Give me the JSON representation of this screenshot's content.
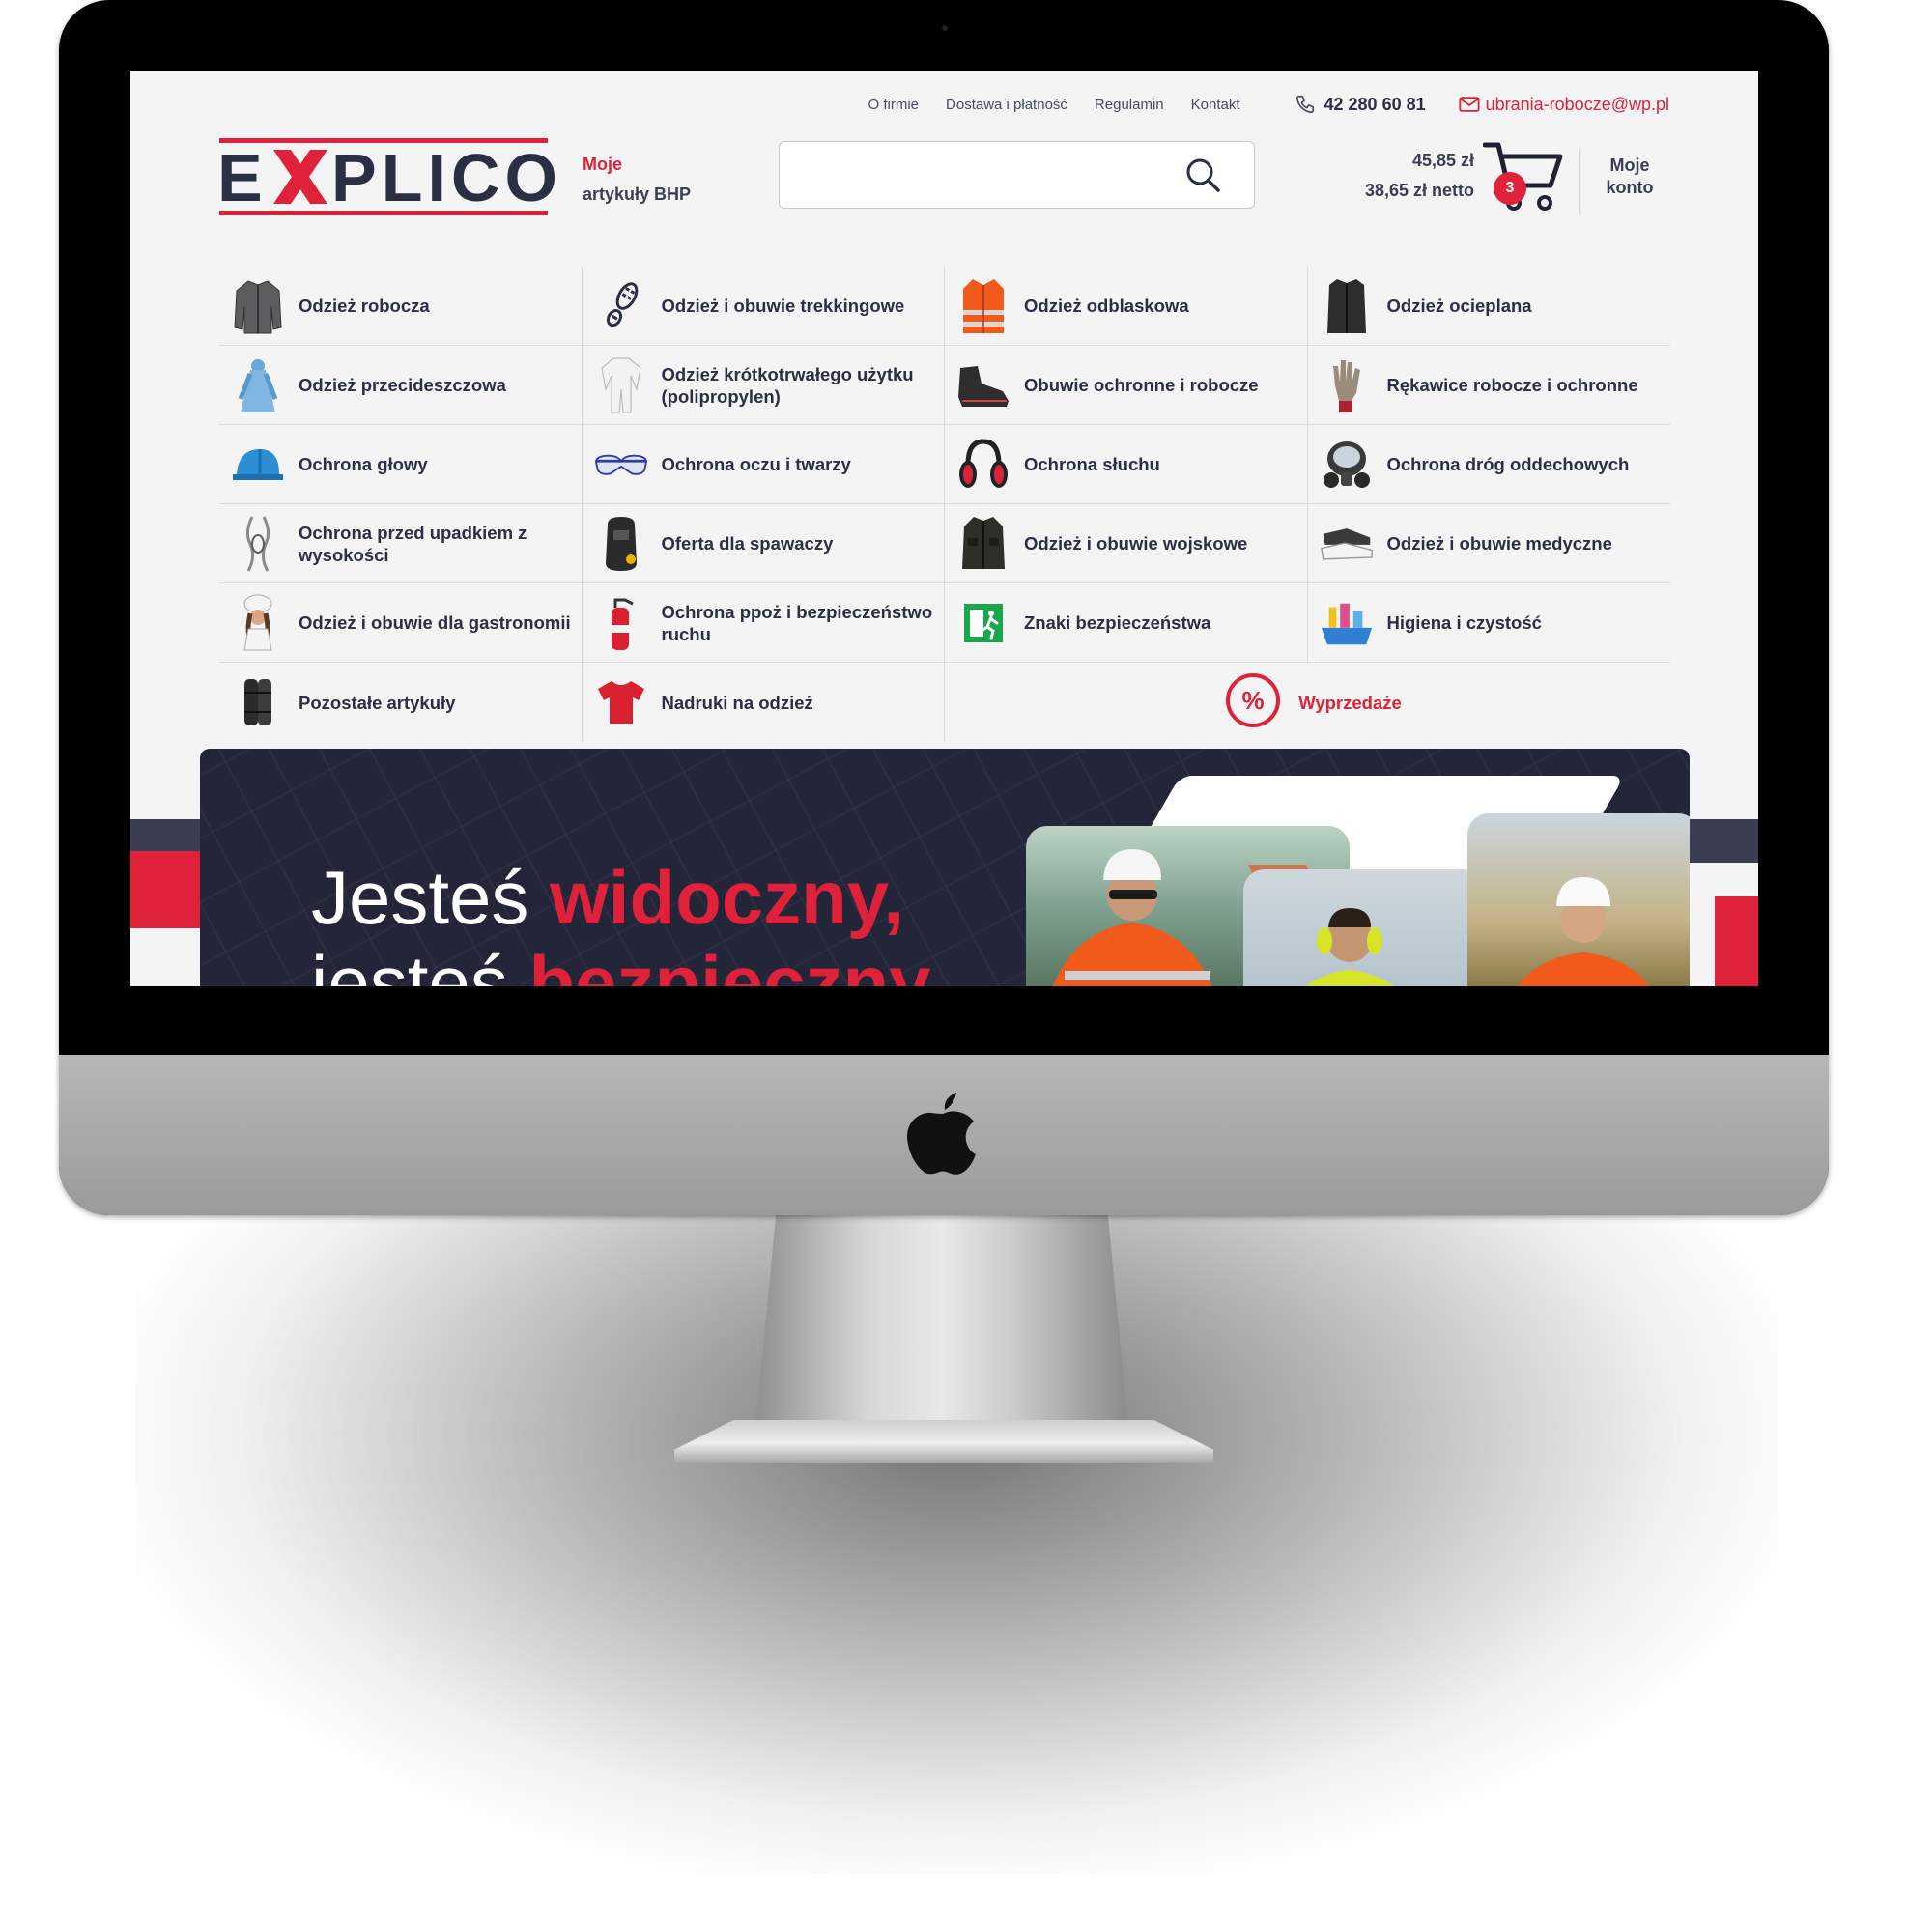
{
  "topnav": {
    "links": [
      "O firmie",
      "Dostawa i płatność",
      "Regulamin",
      "Kontakt"
    ],
    "phone": "42 280 60 81",
    "email": "ubrania-robocze@wp.pl"
  },
  "logo": {
    "text": "EXPLICO"
  },
  "slogan": {
    "line1": "Moje",
    "line2": "artykuły BHP"
  },
  "search": {
    "placeholder": "",
    "value": ""
  },
  "cart": {
    "gross": "45,85 zł",
    "net": "38,65 zł netto",
    "count": "3"
  },
  "account": {
    "line1": "Moje",
    "line2": "konto"
  },
  "categories": [
    {
      "label": "Odzież robocza",
      "icon": "jacket-icon"
    },
    {
      "label": "Odzież i obuwie trekkingowe",
      "icon": "footprint-icon"
    },
    {
      "label": "Odzież odblaskowa",
      "icon": "hi-vis-vest-icon"
    },
    {
      "label": "Odzież ocieplana",
      "icon": "insulated-vest-icon"
    },
    {
      "label": "Odzież przecideszczowa",
      "icon": "raincoat-icon"
    },
    {
      "label": "Odzież krótkotrwałego użytku (polipropylen)",
      "icon": "coverall-icon"
    },
    {
      "label": "Obuwie ochronne i robocze",
      "icon": "safety-boot-icon"
    },
    {
      "label": "Rękawice robocze i ochronne",
      "icon": "glove-icon"
    },
    {
      "label": "Ochrona głowy",
      "icon": "helmet-icon"
    },
    {
      "label": "Ochrona oczu i twarzy",
      "icon": "goggles-icon"
    },
    {
      "label": "Ochrona słuchu",
      "icon": "earmuffs-icon"
    },
    {
      "label": "Ochrona dróg oddechowych",
      "icon": "gas-mask-icon"
    },
    {
      "label": "Ochrona przed upadkiem z wysokości",
      "icon": "harness-icon"
    },
    {
      "label": "Oferta dla spawaczy",
      "icon": "welding-mask-icon"
    },
    {
      "label": "Odzież i obuwie wojskowe",
      "icon": "military-jacket-icon"
    },
    {
      "label": "Odzież i obuwie medyczne",
      "icon": "medical-shoes-icon"
    },
    {
      "label": "Odzież i obuwie dla gastronomii",
      "icon": "chef-icon"
    },
    {
      "label": "Ochrona ppoż i bezpieczeństwo ruchu",
      "icon": "fire-extinguisher-icon"
    },
    {
      "label": "Znaki bezpieczeństwa",
      "icon": "exit-sign-icon"
    },
    {
      "label": "Higiena i czystość",
      "icon": "cleaning-supplies-icon"
    },
    {
      "label": "Pozostałe artykuły",
      "icon": "knee-pads-icon"
    },
    {
      "label": "Nadruki na odzież",
      "icon": "tshirt-icon"
    }
  ],
  "sale": {
    "label": "Wyprzedaże",
    "icon": "percent-icon"
  },
  "hero": {
    "line1_plain": "Jesteś ",
    "line1_accent": "widoczny,",
    "line2_plain": "jesteś ",
    "line2_accent": "bezpieczny"
  },
  "colors": {
    "accent": "#e0213a",
    "navy": "#2b2f44",
    "hero_bg": "#232538"
  }
}
